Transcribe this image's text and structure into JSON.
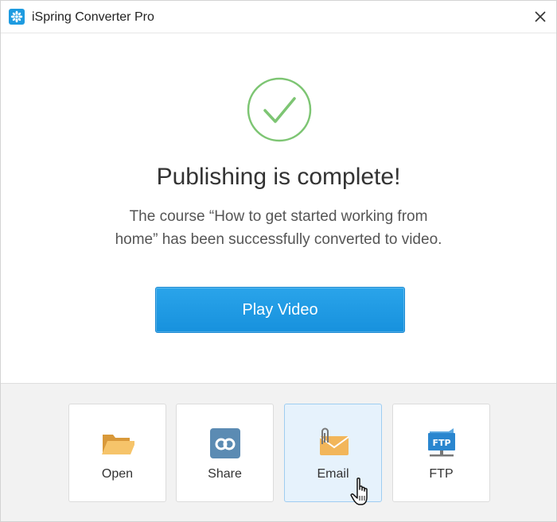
{
  "window": {
    "title": "iSpring Converter Pro"
  },
  "main": {
    "heading": "Publishing is complete!",
    "message_line1": "The course “How to get started working from",
    "message_line2": "home” has been successfully converted to video.",
    "play_button_label": "Play Video"
  },
  "actions": [
    {
      "label": "Open",
      "icon": "folder-icon"
    },
    {
      "label": "Share",
      "icon": "share-icon"
    },
    {
      "label": "Email",
      "icon": "email-icon"
    },
    {
      "label": "FTP",
      "icon": "ftp-icon",
      "icon_text": "FTP"
    }
  ],
  "colors": {
    "accent": "#1e9be0",
    "success": "#7dc573",
    "selected_tile": "#e6f2fc"
  }
}
